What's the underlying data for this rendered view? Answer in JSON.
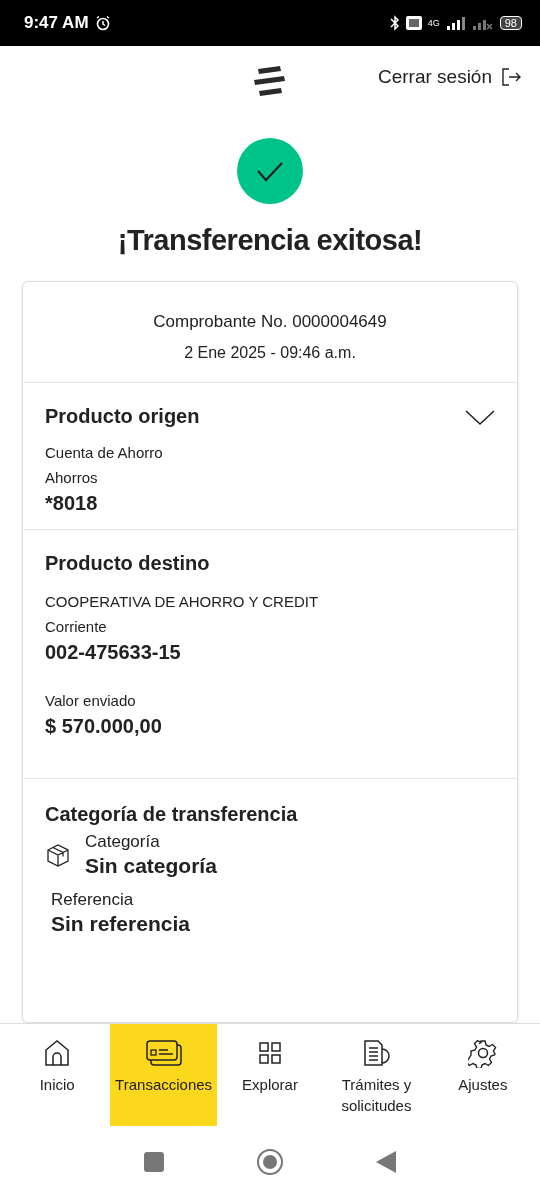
{
  "status_bar": {
    "time": "9:47 AM",
    "network": "4G",
    "battery": "98"
  },
  "header": {
    "logout": "Cerrar sesión"
  },
  "title": "¡Transferencia exitosa!",
  "receipt": {
    "number": "Comprobante No. 0000004649",
    "date": "2 Ene 2025 - 09:46 a.m."
  },
  "origin": {
    "heading": "Producto origen",
    "expanded": false,
    "type": "Cuenta de Ahorro",
    "subtype": "Ahorros",
    "account": "*8018"
  },
  "destination": {
    "heading": "Producto destino",
    "bank": "COOPERATIVA DE AHORRO Y CREDIT",
    "type": "Corriente",
    "account": "002-475633-15",
    "amount_label": "Valor enviado",
    "amount": "$ 570.000,00"
  },
  "category": {
    "heading": "Categoría de transferencia",
    "label": "Categoría",
    "value": "Sin categoría",
    "reference_label": "Referencia",
    "reference": "Sin referencia"
  },
  "nav": [
    {
      "label": "Inicio",
      "kind": "home",
      "selected": false
    },
    {
      "label": "Transacciones",
      "kind": "cards",
      "selected": true
    },
    {
      "label": "Explorar",
      "kind": "grid",
      "selected": false
    },
    {
      "label": "Trámites y solicitudes",
      "kind": "docs",
      "selected": false
    },
    {
      "label": "Ajustes",
      "kind": "gear",
      "selected": false
    }
  ]
}
